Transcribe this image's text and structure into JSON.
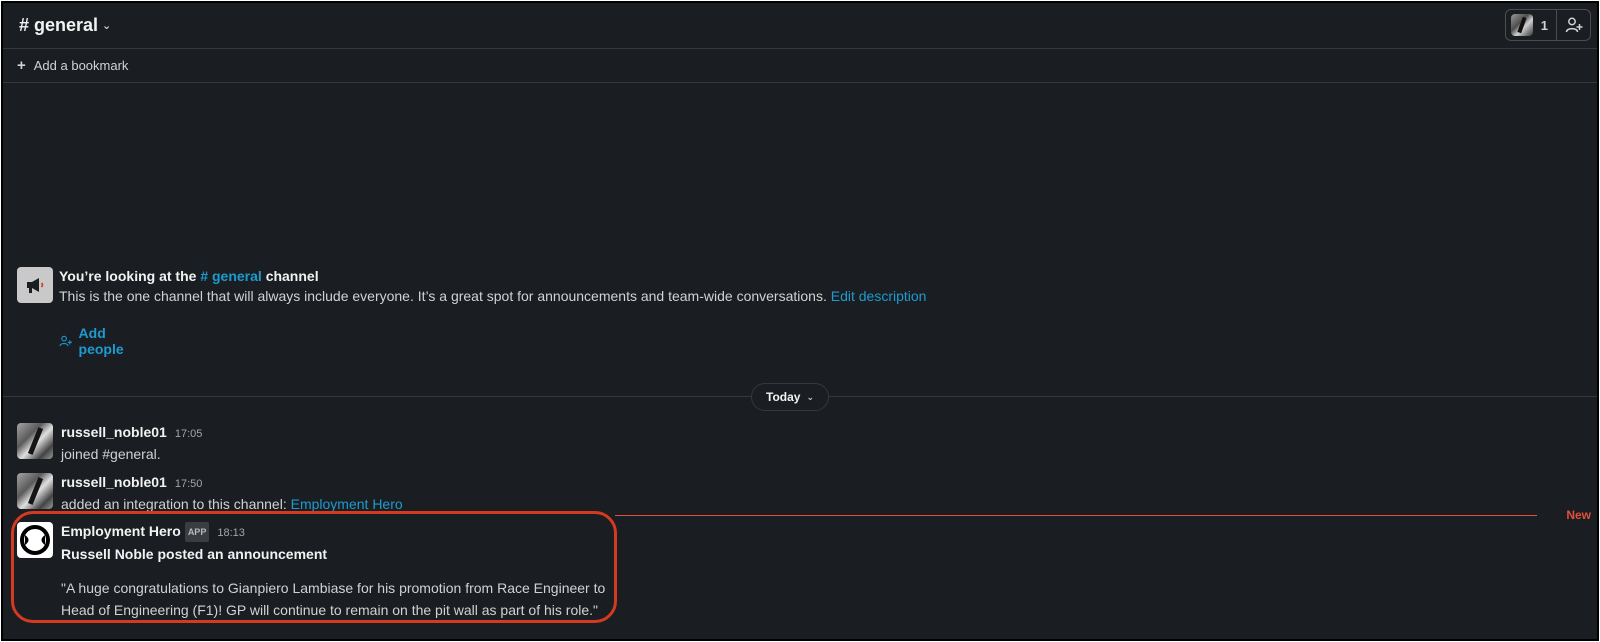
{
  "header": {
    "channel_name": "# general",
    "member_count": "1"
  },
  "bookmark": {
    "label": "Add a bookmark"
  },
  "intro": {
    "title_prefix": "You’re looking at the",
    "title_channel": "# general",
    "title_suffix": "channel",
    "description": "This is the one channel that will always include everyone. It’s a great spot for announcements and team-wide conversations.",
    "edit_link": "Edit description",
    "add_people": "Add people"
  },
  "date_divider": {
    "label": "Today"
  },
  "messages": [
    {
      "author": "russell_noble01",
      "time": "17:05",
      "text": "joined #general."
    },
    {
      "author": "russell_noble01",
      "time": "17:50",
      "text": "added an integration to this channel:",
      "link": "Employment Hero"
    },
    {
      "author": "Employment Hero",
      "badge": "APP",
      "time": "18:13",
      "headline": "Russell Noble posted an announcement",
      "line1": "\"A huge congratulations to Gianpiero Lambiase for his promotion from Race Engineer to",
      "line2": "Head of Engineering (F1)! GP will continue to remain on the pit wall as part of his role.\""
    }
  ],
  "new_marker": "New",
  "colors": {
    "background": "#1a1d21",
    "link": "#1d9bd1",
    "new_line": "#e0513a",
    "highlight": "#d33a20"
  },
  "icons": {
    "intro": "megaphone-icon",
    "add_people": "add-person-icon",
    "add_member": "add-person-icon",
    "bookmark": "plus-icon"
  }
}
